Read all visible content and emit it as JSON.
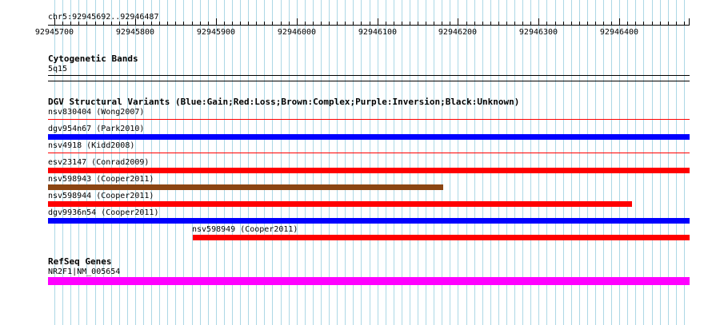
{
  "header": {
    "region": "chr5:92945692..92946487"
  },
  "ruler": {
    "start": 92945692,
    "end": 92946487,
    "ticks": [
      92945700,
      92945800,
      92945900,
      92946000,
      92946100,
      92946200,
      92946300,
      92946400
    ]
  },
  "cytoband": {
    "title": "Cytogenetic Bands",
    "band": "5q15"
  },
  "dgv": {
    "title": "DGV Structural Variants (Blue:Gain;Red:Loss;Brown:Complex;Purple:Inversion;Black:Unknown)",
    "features": [
      {
        "id": "nsv830404",
        "label": "nsv830404 (Wong2007)",
        "start": 92945692,
        "end": 92946487,
        "type": "loss-thin",
        "color": "#ff0000"
      },
      {
        "id": "dgv954n67",
        "label": "dgv954n67 (Park2010)",
        "start": 92945692,
        "end": 92946487,
        "type": "gain",
        "color": "#0000ff"
      },
      {
        "id": "nsv4918",
        "label": "nsv4918 (Kidd2008)",
        "start": 92945692,
        "end": 92946487,
        "type": "loss-thin",
        "color": "#ff0000"
      },
      {
        "id": "esv23147",
        "label": "esv23147 (Conrad2009)",
        "start": 92945692,
        "end": 92946487,
        "type": "loss",
        "color": "#ff0000"
      },
      {
        "id": "nsv598943",
        "label": "nsv598943 (Cooper2011)",
        "start": 92945692,
        "end": 92946182,
        "type": "complex",
        "color": "#8b4513"
      },
      {
        "id": "nsv598944",
        "label": "nsv598944 (Cooper2011)",
        "start": 92945692,
        "end": 92946416,
        "type": "loss",
        "color": "#ff0000"
      },
      {
        "id": "dgv9936n54",
        "label": "dgv9936n54 (Cooper2011)",
        "start": 92945692,
        "end": 92946487,
        "type": "gain",
        "color": "#0000ff"
      },
      {
        "id": "nsv598949",
        "label": "nsv598949 (Cooper2011)",
        "start": 92945871,
        "end": 92946487,
        "type": "loss",
        "color": "#ff0000"
      }
    ]
  },
  "refseq": {
    "title": "RefSeq Genes",
    "genes": [
      {
        "label": "NR2F1|NM_005654",
        "start": 92945692,
        "end": 92946487,
        "color": "#ff00ff"
      }
    ]
  },
  "colors": {
    "grid": "#add8e6",
    "gain": "#0000ff",
    "loss": "#ff0000",
    "complex": "#8b4513",
    "gene": "#ff00ff"
  }
}
